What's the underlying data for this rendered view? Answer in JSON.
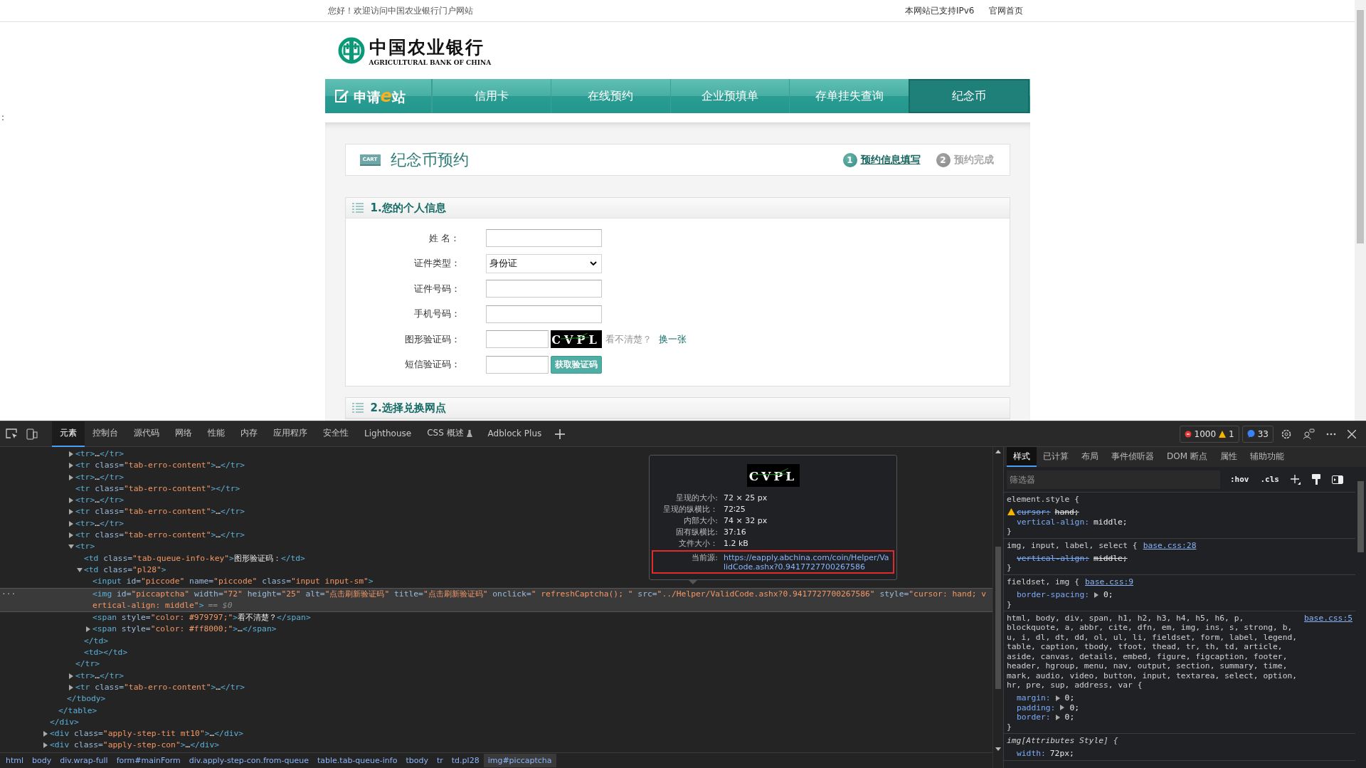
{
  "page": {
    "edge_mark": ":",
    "top_bar": {
      "greeting": "您好！欢迎访问中国农业银行门户网站",
      "links": [
        "本网站已支持IPv6",
        "官网首页"
      ]
    },
    "logo": {
      "name": "中国农业银行",
      "subtitle": "AGRICULTURAL BANK OF CHINA"
    },
    "nav": {
      "brand": {
        "before": "申请",
        "accent": "e",
        "after": "站"
      },
      "items": [
        {
          "label": "信用卡",
          "selected": false
        },
        {
          "label": "在线预约",
          "selected": false
        },
        {
          "label": "企业预填单",
          "selected": false
        },
        {
          "label": "存单挂失查询",
          "selected": false
        },
        {
          "label": "纪念币",
          "selected": true
        }
      ]
    },
    "title_card": {
      "icon_text": "CART",
      "title": "纪念币预约",
      "steps": [
        {
          "number": "1",
          "label": "预约信息填写",
          "selected": true
        },
        {
          "number": "2",
          "label": "预约完成",
          "selected": false
        }
      ]
    },
    "sections": [
      {
        "title": "1.您的个人信息",
        "fields": [
          {
            "kind": "text",
            "label": "姓 名："
          },
          {
            "kind": "select",
            "label": "证件类型：",
            "value": "身份证"
          },
          {
            "kind": "text",
            "label": "证件号码："
          },
          {
            "kind": "text",
            "label": "手机号码："
          },
          {
            "kind": "captcha",
            "label": "图形验证码：",
            "captcha_text": "CVPL",
            "hint": "看不清楚？",
            "link": "换一张"
          },
          {
            "kind": "sms",
            "label": "短信验证码：",
            "button": "获取验证码"
          }
        ]
      },
      {
        "title": "2.选择兑换网点"
      }
    ]
  },
  "devtools": {
    "tabs": [
      {
        "label": "元素",
        "selected": true
      },
      {
        "label": "控制台",
        "selected": false
      },
      {
        "label": "源代码",
        "selected": false
      },
      {
        "label": "网络",
        "selected": false
      },
      {
        "label": "性能",
        "selected": false
      },
      {
        "label": "内存",
        "selected": false
      },
      {
        "label": "应用程序",
        "selected": false
      },
      {
        "label": "安全性",
        "selected": false
      },
      {
        "label": "Lighthouse",
        "selected": false
      },
      {
        "label": "CSS 概述",
        "selected": false,
        "kind": "experiment"
      },
      {
        "label": "Adblock Plus",
        "selected": false
      }
    ],
    "counts": {
      "errors": "1000",
      "warnings": "1",
      "messages": "33"
    },
    "dom_tree": [
      {
        "close": "</div>",
        "children": [
          {
            "close": "</table>",
            "children": [
              {
                "close": "</tbody>",
                "children": [
                  {
                    "open": "<tr>…</tr>",
                    "kind": "collapsed",
                    "selected": false
                  },
                  {
                    "open": "<tr class=\"tab-erro-content\">…</tr>",
                    "kind": "collapsed",
                    "selected": false
                  },
                  {
                    "open": "<tr>…</tr>",
                    "kind": "collapsed",
                    "selected": false
                  },
                  {
                    "open": "<tr class=\"tab-erro-content\"></tr>",
                    "kind": "leaf",
                    "selected": false
                  },
                  {
                    "open": "<tr>…</tr>",
                    "kind": "collapsed",
                    "selected": false
                  },
                  {
                    "open": "<tr class=\"tab-erro-content\">…</tr>",
                    "kind": "collapsed",
                    "selected": false
                  },
                  {
                    "open": "<tr>…</tr>",
                    "kind": "collapsed",
                    "selected": false
                  },
                  {
                    "open": "<tr class=\"tab-erro-content\">…</tr>",
                    "kind": "collapsed",
                    "selected": false
                  },
                  {
                    "open": "<tr>",
                    "close": "</tr>",
                    "kind": "expanded",
                    "selected": false,
                    "children": [
                      {
                        "open": "<td class=\"tab-queue-info-key\">图形验证码：</td>",
                        "kind": "leaf",
                        "selected": false
                      },
                      {
                        "open": "<td class=\"pl28\">",
                        "close": "</td>",
                        "kind": "expanded",
                        "selected": false,
                        "children": [
                          {
                            "open": "<input id=\"piccode\" name=\"piccode\" class=\"input input-sm\">",
                            "kind": "leaf",
                            "selected": false
                          },
                          {
                            "open": "<img id=\"piccaptcha\" width=\"72\" height=\"25\" alt=\"点击刷新验证码\" title=\"点击刷新验证码\" onclick=\" refreshCaptcha(); \" src=\"../Helper/ValidCode.ashx?0.9417727700267586\" style=\"cursor: hand; vertical-align: middle\">",
                            "suffix": "== $0",
                            "gutter": "···",
                            "kind": "leaf",
                            "selected": true
                          },
                          {
                            "open": "<span style=\"color: #979797;\">看不清楚？</span>",
                            "kind": "leaf",
                            "selected": false
                          },
                          {
                            "open": "<span style=\"color: #ff8000;\">…</span>",
                            "kind": "collapsed",
                            "selected": false
                          }
                        ]
                      },
                      {
                        "open": "<td></td>",
                        "kind": "leaf",
                        "selected": false
                      }
                    ]
                  },
                  {
                    "open": "<tr>…</tr>",
                    "kind": "collapsed",
                    "selected": false
                  },
                  {
                    "open": "<tr class=\"tab-erro-content\">…</tr>",
                    "kind": "collapsed",
                    "selected": false
                  }
                ]
              }
            ]
          }
        ]
      },
      {
        "open": "<div class=\"apply-step-tit mt10\">…</div>",
        "kind": "collapsed",
        "selected": false
      },
      {
        "open": "<div class=\"apply-step-con\">…</div>",
        "kind": "collapsed",
        "selected": false
      }
    ],
    "tooltip": {
      "captcha_text": "CVPL",
      "rows": [
        {
          "key": "呈现的大小:",
          "value": "72 × 25 px",
          "highlighted": false,
          "kind": "plain"
        },
        {
          "key": "呈现的纵横比：",
          "value": "72∶25",
          "highlighted": false,
          "kind": "plain"
        },
        {
          "key": "内部大小:",
          "value": "74 × 32 px",
          "highlighted": false,
          "kind": "plain"
        },
        {
          "key": "固有纵横比:",
          "value": "37:16",
          "highlighted": false,
          "kind": "plain"
        },
        {
          "key": "文件大小：",
          "value": "1.2 kB",
          "highlighted": false,
          "kind": "plain"
        },
        {
          "key": "当前源:",
          "value": "https://eapply.abchina.com/coin/Helper/ValidCode.ashx?0.9417727700267586",
          "highlighted": true,
          "kind": "link"
        }
      ]
    },
    "breadcrumb": [
      {
        "label": "html",
        "selected": false
      },
      {
        "label": "body",
        "selected": false
      },
      {
        "label": "div.wrap-full",
        "selected": false
      },
      {
        "label": "form#mainForm",
        "selected": false
      },
      {
        "label": "div.apply-step-con.from-queue",
        "selected": false
      },
      {
        "label": "table.tab-queue-info",
        "selected": false
      },
      {
        "label": "tbody",
        "selected": false
      },
      {
        "label": "tr",
        "selected": false
      },
      {
        "label": "td.pl28",
        "selected": false
      },
      {
        "label": "img#piccaptcha",
        "selected": true
      }
    ],
    "styles": {
      "tabs": [
        {
          "label": "样式",
          "selected": true
        },
        {
          "label": "已计算",
          "selected": false
        },
        {
          "label": "布局",
          "selected": false
        },
        {
          "label": "事件侦听器",
          "selected": false
        },
        {
          "label": "DOM 断点",
          "selected": false
        },
        {
          "label": "属性",
          "selected": false
        },
        {
          "label": "辅助功能",
          "selected": false
        }
      ],
      "filter_placeholder": "筛选器",
      "toolbar": [
        ":hov",
        ".cls"
      ],
      "rules": [
        {
          "kind": "inline",
          "selector": "element.style {",
          "declarations": [
            {
              "name": "cursor:",
              "value": "hand;",
              "struck": true,
              "warning": true,
              "expandable": false
            },
            {
              "name": "vertical-align:",
              "value": "middle;",
              "struck": false,
              "warning": false,
              "expandable": false
            }
          ],
          "close": "}"
        },
        {
          "kind": "rule",
          "selector": "img, input, label, select {",
          "source": "base.css:28",
          "declarations": [
            {
              "name": "vertical-align:",
              "value": "middle;",
              "struck": true,
              "warning": false,
              "expandable": false
            }
          ],
          "close": "}"
        },
        {
          "kind": "rule",
          "selector": "fieldset, img {",
          "source": "base.css:9",
          "declarations": [
            {
              "name": "border-spacing:",
              "value": "0;",
              "struck": false,
              "warning": false,
              "expandable": true
            }
          ],
          "close": "}"
        },
        {
          "kind": "rule",
          "selector": "html, body, div, span, h1, h2, h3, h4, h5, h6, p, blockquote, a, abbr, cite, dfn, em, img, ins, s, strong, b, u, i, dl, dt, dd, ol, ul, li, fieldset, form, label, legend, table, caption, tbody, tfoot, thead, tr, th, td, article, aside, canvas, details, embed, figure, figcaption, footer, header, hgroup, menu, nav, output, section, summary, time, mark, audio, video, button, input, textarea, select, option, hr, pre, sup, address, var {",
          "source": "base.css:5",
          "declarations": [
            {
              "name": "margin:",
              "value": "0;",
              "struck": false,
              "warning": false,
              "expandable": true
            },
            {
              "name": "padding:",
              "value": "0;",
              "struck": false,
              "warning": false,
              "expandable": true
            },
            {
              "name": "border:",
              "value": "0;",
              "struck": false,
              "warning": false,
              "expandable": true
            }
          ],
          "close": "}"
        },
        {
          "kind": "attributes",
          "selector": "img[Attributes Style] {",
          "declarations": [
            {
              "name": "width:",
              "value": "72px;",
              "struck": false,
              "warning": false,
              "expandable": false
            }
          ]
        }
      ]
    }
  }
}
